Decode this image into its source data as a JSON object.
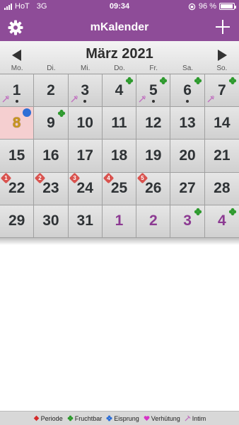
{
  "status": {
    "carrier": "HoT",
    "network": "3G",
    "time": "09:34",
    "battery": "96 %",
    "battery_level": 0.96
  },
  "navbar": {
    "title": "mKalender",
    "settings_icon": "gear-icon",
    "add_icon": "plus-icon"
  },
  "month": {
    "title": "März 2021",
    "prev_icon": "triangle-left-icon",
    "next_icon": "triangle-right-icon"
  },
  "weekdays": [
    "Mo.",
    "Di.",
    "Mi.",
    "Do.",
    "Fr.",
    "Sa.",
    "So."
  ],
  "days": [
    {
      "label": "1",
      "intim": true,
      "dot": true
    },
    {
      "label": "2"
    },
    {
      "label": "3",
      "intim": true,
      "dot": true
    },
    {
      "label": "4",
      "clover": true
    },
    {
      "label": "5",
      "clover": true,
      "intim": true,
      "dot": true
    },
    {
      "label": "6",
      "clover": true,
      "dot": true
    },
    {
      "label": "7",
      "clover": true,
      "intim": true
    },
    {
      "label": "8",
      "today": true,
      "eisprung": true
    },
    {
      "label": "9",
      "clover": true
    },
    {
      "label": "10"
    },
    {
      "label": "11"
    },
    {
      "label": "12"
    },
    {
      "label": "13"
    },
    {
      "label": "14"
    },
    {
      "label": "15"
    },
    {
      "label": "16"
    },
    {
      "label": "17"
    },
    {
      "label": "18"
    },
    {
      "label": "19"
    },
    {
      "label": "20"
    },
    {
      "label": "21"
    },
    {
      "label": "22",
      "period": "1"
    },
    {
      "label": "23",
      "period": "2"
    },
    {
      "label": "24",
      "period": "3"
    },
    {
      "label": "25",
      "period": "4"
    },
    {
      "label": "26",
      "period": "5"
    },
    {
      "label": "27"
    },
    {
      "label": "28"
    },
    {
      "label": "29"
    },
    {
      "label": "30"
    },
    {
      "label": "31"
    },
    {
      "label": "1",
      "next": true
    },
    {
      "label": "2",
      "next": true
    },
    {
      "label": "3",
      "next": true,
      "clover": true
    },
    {
      "label": "4",
      "next": true,
      "clover": true
    }
  ],
  "legend": [
    {
      "label": "Periode",
      "icon": "red-diamond-icon",
      "color": "#d42b2b"
    },
    {
      "label": "Fruchtbar",
      "icon": "clover-icon",
      "color": "#2e9a2e"
    },
    {
      "label": "Eisprung",
      "icon": "blue-flower-icon",
      "color": "#2f6fd6"
    },
    {
      "label": "Verhütung",
      "icon": "heart-icon",
      "color": "#d633c6"
    },
    {
      "label": "Intim",
      "icon": "intim-icon",
      "color": "#c06fbf"
    }
  ],
  "colors": {
    "accent": "#8e4c98",
    "today_bg": "#f5cfd0",
    "period_badge": "#d9534f"
  }
}
